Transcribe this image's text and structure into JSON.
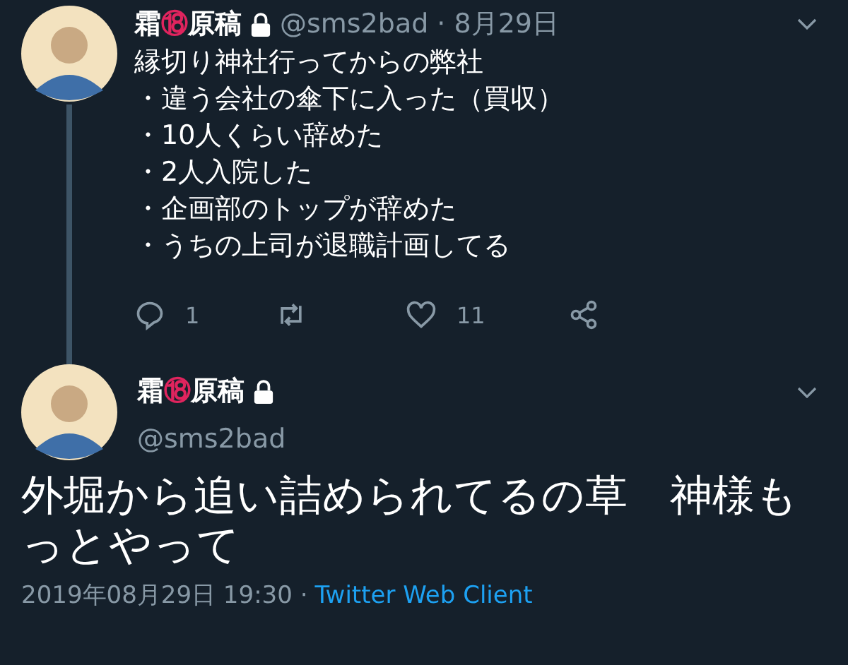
{
  "tweet": {
    "name_before": "霜",
    "name_mark": "⑱",
    "name_after": "原稿",
    "protected": true,
    "handle": "@sms2bad",
    "date": "· 8月29日",
    "lines": [
      "縁切り神社行ってからの弊社",
      "・違う会社の傘下に入った（買収）",
      "・10人くらい辞めた",
      "・2人入院した",
      "・企画部のトップが辞めた",
      "・うちの上司が退職計画してる"
    ],
    "replies": "1",
    "likes": "11"
  },
  "reply": {
    "name_before": "霜",
    "name_mark": "⑱",
    "name_after": "原稿",
    "protected": true,
    "handle": "@sms2bad",
    "text": "外堀から追い詰められてるの草　神様もっとやって",
    "timestamp": "2019年08月29日 19:30 ·",
    "source": "Twitter Web Client"
  }
}
